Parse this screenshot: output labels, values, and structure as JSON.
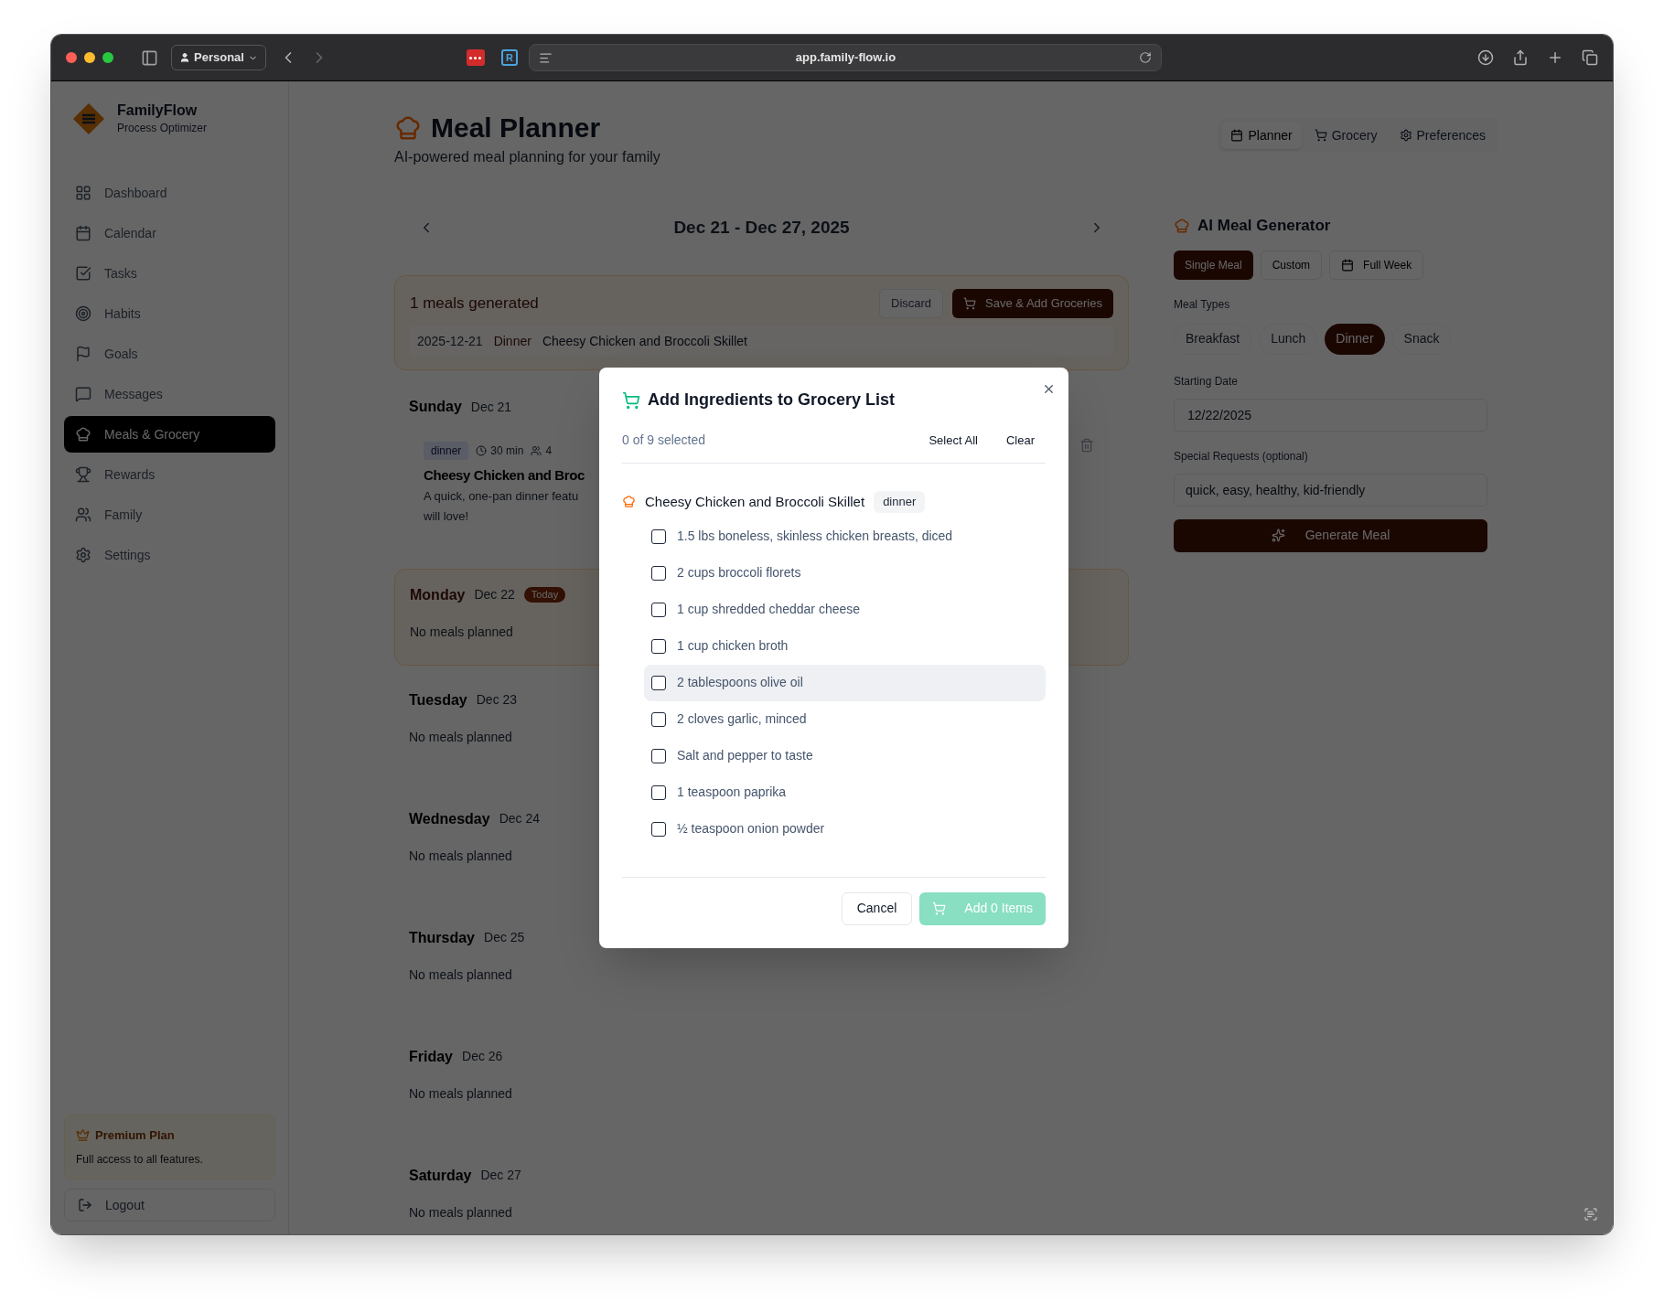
{
  "browser": {
    "profile": "Personal",
    "extension_badge": "R",
    "url": "app.family-flow.io"
  },
  "sidebar": {
    "brand": {
      "name": "FamilyFlow",
      "tagline": "Process Optimizer"
    },
    "items": [
      {
        "label": "Dashboard",
        "selected": false
      },
      {
        "label": "Calendar",
        "selected": false
      },
      {
        "label": "Tasks",
        "selected": false
      },
      {
        "label": "Habits",
        "selected": false
      },
      {
        "label": "Goals",
        "selected": false
      },
      {
        "label": "Messages",
        "selected": false
      },
      {
        "label": "Meals & Grocery",
        "selected": true
      },
      {
        "label": "Rewards",
        "selected": false
      },
      {
        "label": "Family",
        "selected": false
      },
      {
        "label": "Settings",
        "selected": false
      }
    ],
    "premium": {
      "title": "Premium Plan",
      "text": "Full access to all features."
    },
    "logout": "Logout"
  },
  "header": {
    "title": "Meal Planner",
    "subtitle": "AI-powered meal planning for your family"
  },
  "view_tabs": [
    {
      "label": "Planner",
      "selected": true
    },
    {
      "label": "Grocery",
      "selected": false
    },
    {
      "label": "Preferences",
      "selected": false
    }
  ],
  "week": {
    "range": "Dec 21 - Dec 27, 2025"
  },
  "generated": {
    "title": "1 meals generated",
    "discard": "Discard",
    "save": "Save & Add Groceries",
    "rows": [
      {
        "date": "2025-12-21",
        "type": "Dinner",
        "name": "Cheesy Chicken and Broccoli Skillet"
      }
    ]
  },
  "days": [
    {
      "day": "Sunday",
      "date": "Dec 21",
      "today": false,
      "meals": [
        {
          "tag": "dinner",
          "time": "30 min",
          "servings": "4",
          "name": "Cheesy Chicken and Broc",
          "description_lines": [
            "A quick, one-pan dinner featu",
            "will love!"
          ]
        }
      ]
    },
    {
      "day": "Monday",
      "date": "Dec 22",
      "today": true,
      "badge": "Today",
      "empty": "No meals planned"
    },
    {
      "day": "Tuesday",
      "date": "Dec 23",
      "today": false,
      "empty": "No meals planned"
    },
    {
      "day": "Wednesday",
      "date": "Dec 24",
      "today": false,
      "empty": "No meals planned"
    },
    {
      "day": "Thursday",
      "date": "Dec 25",
      "today": false,
      "empty": "No meals planned"
    },
    {
      "day": "Friday",
      "date": "Dec 26",
      "today": false,
      "empty": "No meals planned"
    },
    {
      "day": "Saturday",
      "date": "Dec 27",
      "today": false,
      "empty": "No meals planned"
    }
  ],
  "ai_generator": {
    "title": "AI Meal Generator",
    "modes": [
      {
        "label": "Single Meal",
        "selected": true
      },
      {
        "label": "Custom",
        "selected": false
      },
      {
        "label": "Full Week",
        "selected": false
      }
    ],
    "meal_types_label": "Meal Types",
    "meal_types": [
      {
        "label": "Breakfast",
        "selected": false
      },
      {
        "label": "Lunch",
        "selected": false
      },
      {
        "label": "Dinner",
        "selected": true
      },
      {
        "label": "Snack",
        "selected": false
      }
    ],
    "start_date_label": "Starting Date",
    "start_date": "12/22/2025",
    "requests_label": "Special Requests (optional)",
    "requests_value": "quick, easy, healthy, kid-friendly",
    "generate": "Generate Meal"
  },
  "modal": {
    "title": "Add Ingredients to Grocery List",
    "count": "0 of 9 selected",
    "select_all": "Select All",
    "clear": "Clear",
    "recipe": {
      "name": "Cheesy Chicken and Broccoli Skillet",
      "tag": "dinner"
    },
    "ingredients": [
      {
        "label": "1.5 lbs boneless, skinless chicken breasts, diced",
        "checked": false,
        "highlighted": false
      },
      {
        "label": "2 cups broccoli florets",
        "checked": false,
        "highlighted": false
      },
      {
        "label": "1 cup shredded cheddar cheese",
        "checked": false,
        "highlighted": false
      },
      {
        "label": "1 cup chicken broth",
        "checked": false,
        "highlighted": false
      },
      {
        "label": "2 tablespoons olive oil",
        "checked": false,
        "highlighted": true
      },
      {
        "label": "2 cloves garlic, minced",
        "checked": false,
        "highlighted": false
      },
      {
        "label": "Salt and pepper to taste",
        "checked": false,
        "highlighted": false
      },
      {
        "label": "1 teaspoon paprika",
        "checked": false,
        "highlighted": false
      },
      {
        "label": "½ teaspoon onion powder",
        "checked": false,
        "highlighted": false
      }
    ],
    "cancel": "Cancel",
    "add": "Add 0 Items",
    "add_disabled": true
  }
}
